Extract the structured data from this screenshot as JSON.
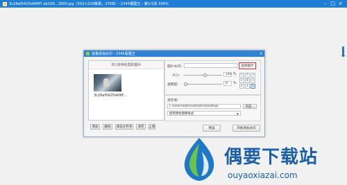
{
  "viewer": {
    "title": "3c28af5425d49ff7.de106...2000.jpg（552×220像素，27KB）- 2345看图王 - 第1/1张 100%",
    "controls": [
      "–",
      "□",
      "×"
    ]
  },
  "dialog": {
    "title": "批量添加水印 - 2345看图王",
    "close": "×",
    "left_header": "共1张待处理的图片",
    "thumb_name": "3c28af5425d49ff...",
    "buttons": {
      "add": "添加",
      "delete": "删除",
      "add_folder": "添加文件夹",
      "clear": "清空",
      "up": "上移"
    },
    "watermark": {
      "image_label": "图片水印：",
      "image_path": "",
      "choose_button": "选择图片",
      "size_label": "大小：",
      "size_value": "100",
      "size_unit": "%",
      "opacity_label": "透明度：",
      "opacity_value": "0",
      "opacity_unit": "%",
      "size_level": 0.55,
      "opacity_level": 0.05,
      "position_glyphs": [
        "↖",
        "↑",
        "↗",
        "←",
        "✛",
        "→",
        "↙",
        "↓",
        "↘"
      ]
    },
    "output": {
      "label": "另存到：",
      "path": "C:\\Users\\Administrator\\Desktop\\",
      "browse": "浏览...",
      "format_select": "使用原始图像格式"
    },
    "preview": "预览",
    "start": "开始添加水印"
  },
  "watermark_site": {
    "brand": "偶要下载站",
    "url": "ouyaoxiazai.com"
  },
  "colors": {
    "accent": "#2f83d4",
    "highlight": "#e0282d",
    "brand": "#1b5fa8"
  }
}
